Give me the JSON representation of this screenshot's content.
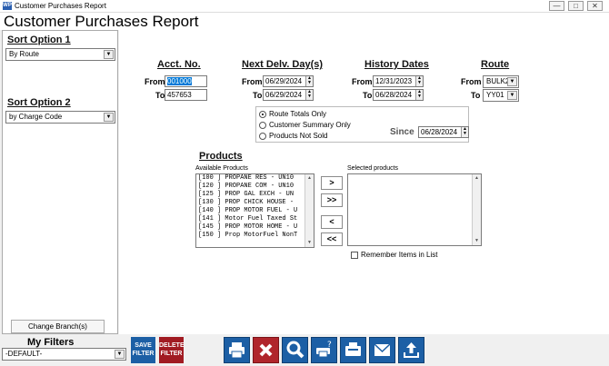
{
  "window": {
    "title": "Customer Purchases Report",
    "app_icon_text": "WP"
  },
  "report_title": "Customer Purchases Report",
  "sidebar": {
    "sort1": {
      "label": "Sort Option 1",
      "value": "By Route"
    },
    "sort2": {
      "label": "Sort Option 2",
      "value": "by Charge Code"
    },
    "change_branch": "Change Branch(s)"
  },
  "acct": {
    "label": "Acct. No.",
    "from_label": "From",
    "from": "001000",
    "to_label": "To",
    "to": "457653"
  },
  "delivery": {
    "label": "Next Delv. Day(s)",
    "from_label": "From",
    "from": "06/29/2024",
    "to_label": "To",
    "to": "06/29/2024"
  },
  "history": {
    "label": "History Dates",
    "from_label": "From",
    "from": "12/31/2023",
    "to_label": "To",
    "to": "06/28/2024"
  },
  "route": {
    "label": "Route",
    "from_label": "From",
    "from": "BULK2",
    "to_label": "To",
    "to": "YY01"
  },
  "options": {
    "items": [
      "Route Totals Only",
      "Customer Summary Only",
      "Products Not Sold"
    ],
    "selected": 0,
    "since_label": "Since",
    "since": "06/28/2024"
  },
  "products": {
    "label": "Products",
    "available_label": "Available Products",
    "selected_label": "Selected products",
    "items": [
      "[100  ] PROPANE RES - UN10",
      "[120  ] PROPANE COM - UN10",
      "[125  ] PROP GAL EXCH - UN",
      "[130  ] PROP CHICK HOUSE -",
      "[140  ] PROP MOTOR FUEL - U",
      "[141  ] Motor Fuel Taxed St",
      "[145  ] PROP MOTOR HOME - U",
      "[150  ] Prop MotorFuel NonT"
    ],
    "move_buttons": [
      ">",
      ">>",
      "<",
      "<<"
    ],
    "remember_label": "Remember Items in List"
  },
  "filters": {
    "label": "My Filters",
    "value": "-DEFAULT-",
    "save": "SAVE FILTER",
    "delete": "DELETE FILTER"
  },
  "toolbar_icons": [
    "print-icon",
    "cancel-icon",
    "preview-icon",
    "print-setup-icon",
    "fax-icon",
    "email-icon",
    "export-icon"
  ],
  "colors": {
    "save": "#1c5fa5",
    "delete": "#a11b22",
    "toolbar": "#1c5fa5",
    "selection": "#0078d7"
  }
}
